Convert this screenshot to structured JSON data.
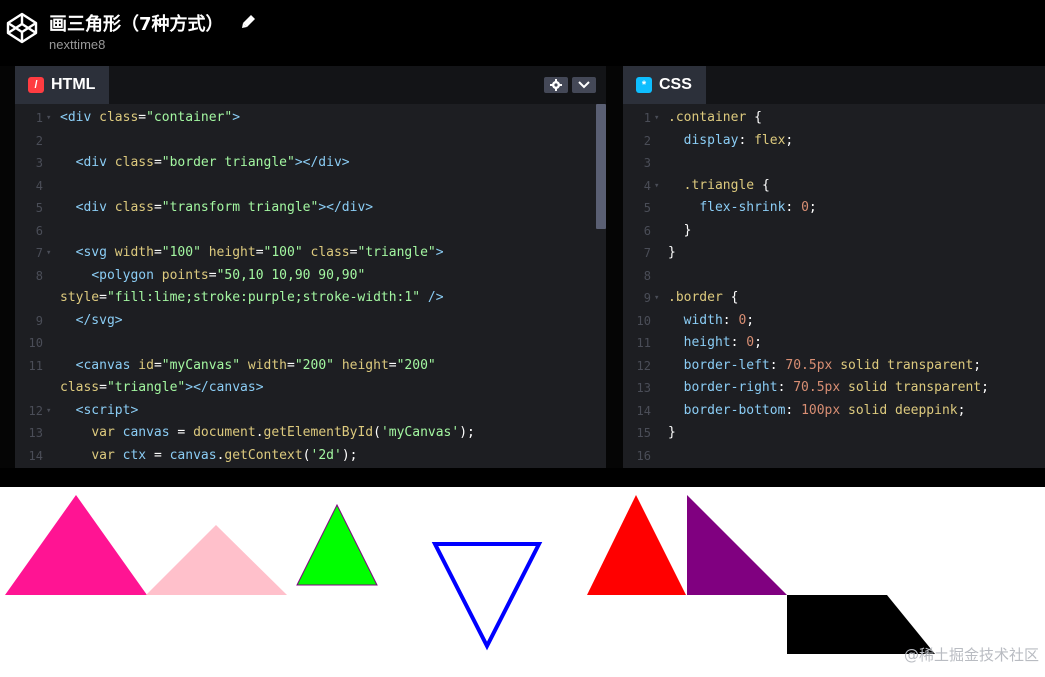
{
  "header": {
    "title": "画三角形（7种方式）",
    "author": "nexttime8"
  },
  "html_panel": {
    "tab_label": "HTML",
    "tab_icon": "html-badge-icon",
    "accent": "#ff3c41",
    "lines": [
      {
        "n": "1",
        "fold": true,
        "text": "<div class=\"container\">"
      },
      {
        "n": "2",
        "fold": false,
        "text": ""
      },
      {
        "n": "3",
        "fold": false,
        "text": "  <div class=\"border triangle\"></div>"
      },
      {
        "n": "4",
        "fold": false,
        "text": ""
      },
      {
        "n": "5",
        "fold": false,
        "text": "  <div class=\"transform triangle\"></div>"
      },
      {
        "n": "6",
        "fold": false,
        "text": ""
      },
      {
        "n": "7",
        "fold": true,
        "text": "  <svg width=\"100\" height=\"100\" class=\"triangle\">"
      },
      {
        "n": "8",
        "fold": false,
        "text": "    <polygon points=\"50,10 10,90 90,90\""
      },
      {
        "n": "",
        "fold": false,
        "text": "style=\"fill:lime;stroke:purple;stroke-width:1\" />"
      },
      {
        "n": "9",
        "fold": false,
        "text": "  </svg>"
      },
      {
        "n": "10",
        "fold": false,
        "text": ""
      },
      {
        "n": "11",
        "fold": false,
        "text": "  <canvas id=\"myCanvas\" width=\"200\" height=\"200\""
      },
      {
        "n": "",
        "fold": false,
        "text": "class=\"triangle\"></canvas>"
      },
      {
        "n": "12",
        "fold": true,
        "text": "  <script>"
      },
      {
        "n": "13",
        "fold": false,
        "text": "    var canvas = document.getElementById('myCanvas');"
      },
      {
        "n": "14",
        "fold": false,
        "text": "    var ctx = canvas.getContext('2d');"
      }
    ]
  },
  "css_panel": {
    "tab_label": "CSS",
    "tab_icon": "css-badge-icon",
    "accent": "#0ebeff",
    "lines": [
      {
        "n": "1",
        "fold": true,
        "text": ".container {"
      },
      {
        "n": "2",
        "fold": false,
        "text": "  display: flex;"
      },
      {
        "n": "3",
        "fold": false,
        "text": ""
      },
      {
        "n": "4",
        "fold": true,
        "text": "  .triangle {"
      },
      {
        "n": "5",
        "fold": false,
        "text": "    flex-shrink: 0;"
      },
      {
        "n": "6",
        "fold": false,
        "text": "  }"
      },
      {
        "n": "7",
        "fold": false,
        "text": "}"
      },
      {
        "n": "8",
        "fold": false,
        "text": ""
      },
      {
        "n": "9",
        "fold": true,
        "text": ".border {"
      },
      {
        "n": "10",
        "fold": false,
        "text": "  width: 0;"
      },
      {
        "n": "11",
        "fold": false,
        "text": "  height: 0;"
      },
      {
        "n": "12",
        "fold": false,
        "text": "  border-left: 70.5px solid transparent;"
      },
      {
        "n": "13",
        "fold": false,
        "text": "  border-right: 70.5px solid transparent;"
      },
      {
        "n": "14",
        "fold": false,
        "text": "  border-bottom: 100px solid deeppink;"
      },
      {
        "n": "15",
        "fold": false,
        "text": "}"
      },
      {
        "n": "16",
        "fold": false,
        "text": ""
      }
    ]
  },
  "result": {
    "colors": {
      "deeppink": "#ff1493",
      "pink": "#ffc0cb",
      "lime": "#00ff00",
      "blue": "#0000ff",
      "red": "#ff0000",
      "purple": "#800080",
      "black": "#000000"
    }
  },
  "watermark": "@稀土掘金技术社区"
}
